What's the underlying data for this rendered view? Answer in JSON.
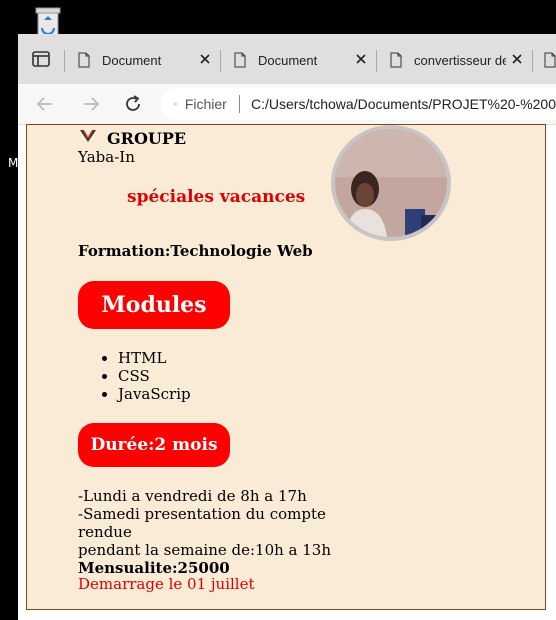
{
  "desktop": {
    "label_fragment": "M"
  },
  "browser": {
    "tabs": [
      {
        "title": "Document"
      },
      {
        "title": "Document"
      },
      {
        "title": "convertisseur de"
      }
    ],
    "address": {
      "scheme_label": "Fichier",
      "url": "C:/Users/tchowa/Documents/PROJET%20-%200"
    }
  },
  "page": {
    "brand": "GROUPE",
    "brand_sub": "Yaba-In",
    "promo": "spéciales vacances",
    "formation": "Formation:Technologie Web",
    "modules_label": "Modules",
    "modules": [
      "HTML",
      "CSS",
      "JavaScrip"
    ],
    "duree_label": "Durée:2 mois",
    "schedule": {
      "line1": "-Lundi a vendredi de 8h a 17h",
      "line2": "-Samedi presentation du compte rendue",
      "line3": "pendant la semaine de:10h a 13h",
      "mensualite": "Mensualite:25000"
    },
    "start": "Demarrage le 01 juillet"
  },
  "colors": {
    "accent_red": "#ff0000",
    "page_bg": "#faebd7",
    "border": "#8b4513"
  }
}
